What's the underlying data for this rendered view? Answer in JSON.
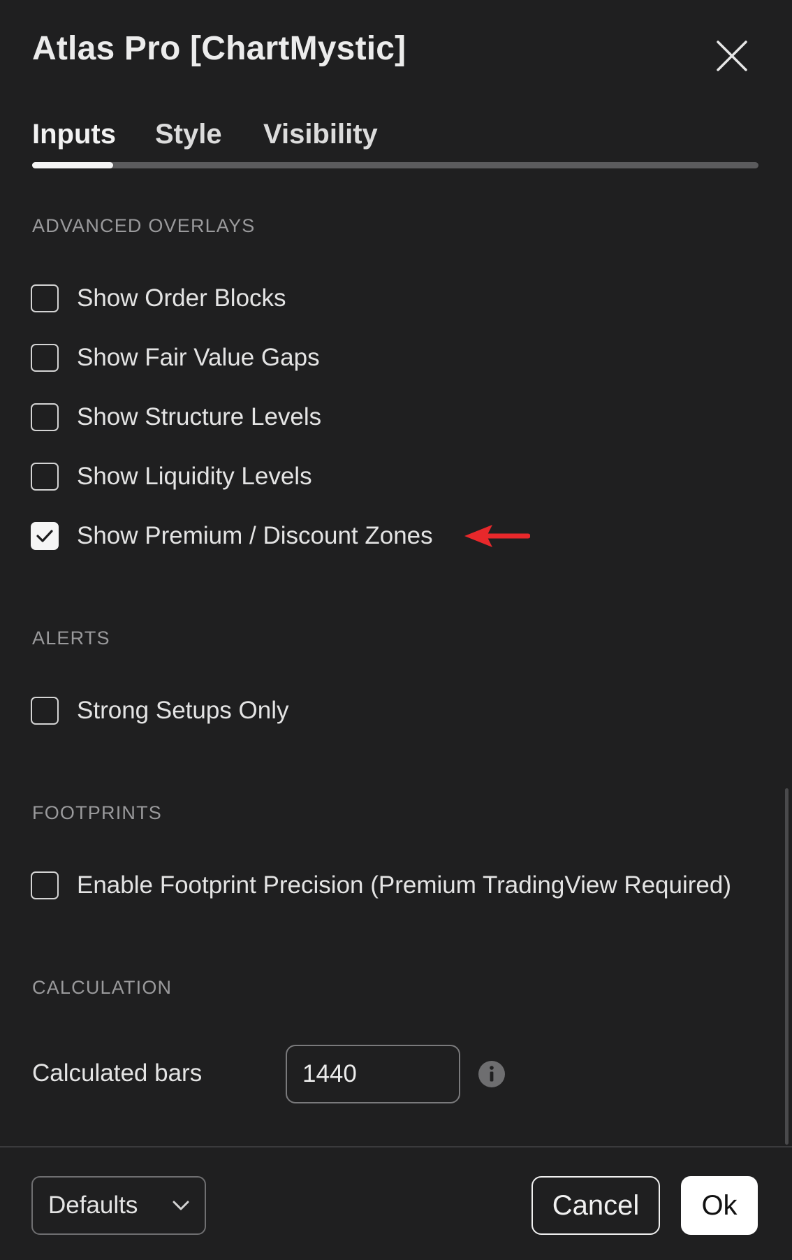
{
  "dialog": {
    "title": "Atlas Pro [ChartMystic]"
  },
  "tabs": [
    {
      "label": "Inputs",
      "active": true
    },
    {
      "label": "Style",
      "active": false
    },
    {
      "label": "Visibility",
      "active": false
    }
  ],
  "sections": {
    "advanced_overlays": {
      "heading": "ADVANCED OVERLAYS",
      "items": [
        {
          "label": "Show Order Blocks",
          "checked": false
        },
        {
          "label": "Show Fair Value Gaps",
          "checked": false
        },
        {
          "label": "Show Structure Levels",
          "checked": false
        },
        {
          "label": "Show Liquidity Levels",
          "checked": false
        },
        {
          "label": "Show Premium / Discount Zones",
          "checked": true
        }
      ]
    },
    "alerts": {
      "heading": "ALERTS",
      "items": [
        {
          "label": "Strong Setups Only",
          "checked": false
        }
      ]
    },
    "footprints": {
      "heading": "FOOTPRINTS",
      "items": [
        {
          "label": "Enable Footprint Precision (Premium TradingView Required)",
          "checked": false
        }
      ]
    },
    "calculation": {
      "heading": "CALCULATION",
      "calculated_bars_label": "Calculated bars",
      "calculated_bars_value": "1440"
    }
  },
  "footer": {
    "defaults_label": "Defaults",
    "cancel_label": "Cancel",
    "ok_label": "Ok"
  },
  "icons": {
    "close": "close-icon",
    "info": "info-icon",
    "chevron": "chevron-down-icon",
    "check": "checkmark-icon",
    "annotation": "arrow-left-icon"
  },
  "colors": {
    "background": "#1f1f20",
    "text": "#e4e4e4",
    "section_heading": "#9a9a9c",
    "annotation_arrow": "#e8282b",
    "ok_button_bg": "#ffffff"
  }
}
